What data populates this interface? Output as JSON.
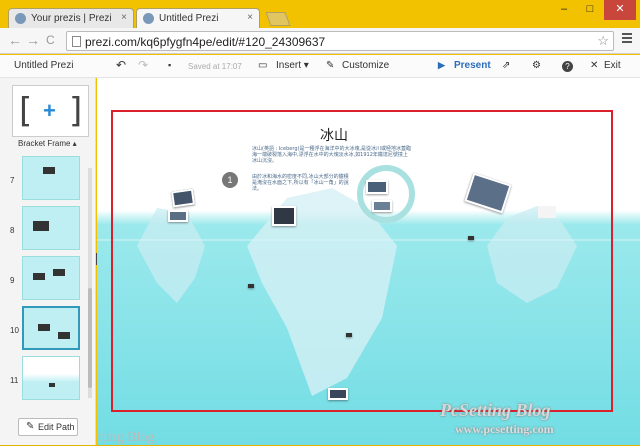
{
  "browser": {
    "tabs": [
      {
        "label": "Your prezis | Prezi",
        "close": "×"
      },
      {
        "label": "Untitled Prezi",
        "close": "×"
      }
    ],
    "window_controls": {
      "minimize": "–",
      "maximize": "□",
      "close": "✕"
    },
    "back": "←",
    "forward": "→",
    "reload": "C",
    "url": "prezi.com/kq6pfygfn4pe/edit/#120_24309637"
  },
  "prezi_bar": {
    "title": "Untitled Prezi",
    "undo": "↶",
    "redo": "↷",
    "saved": "Saved at 17:07",
    "insert": "Insert ▾",
    "customize": "Customize",
    "present": "Present",
    "exit": "Exit"
  },
  "left_panel": {
    "frame_type": "Bracket Frame ▴",
    "thumbnails": [
      {
        "num": "7"
      },
      {
        "num": "8"
      },
      {
        "num": "9"
      },
      {
        "num": "10"
      },
      {
        "num": "11"
      }
    ],
    "edit_path": "Edit Path"
  },
  "canvas": {
    "title": "冰山",
    "body_1": "冰山(英語 : Iceberg)是一種浮在海洋中的大冰塊,是從冰川或極地冰蓋臨海一端破裂落入海中,漂浮在水中的大塊淡水冰,如1912年鐵達尼號撞上冰山沉沒。",
    "body_2": "由於冰和海水的密度不同,冰山大部分的體積是淹沒在水面之下,所以有「冰山一角」的說法。",
    "step": "1"
  },
  "watermark": {
    "line1": "PcSetting Blog",
    "line2": "www.pcsetting.com",
    "ghost": "tting Blog"
  }
}
